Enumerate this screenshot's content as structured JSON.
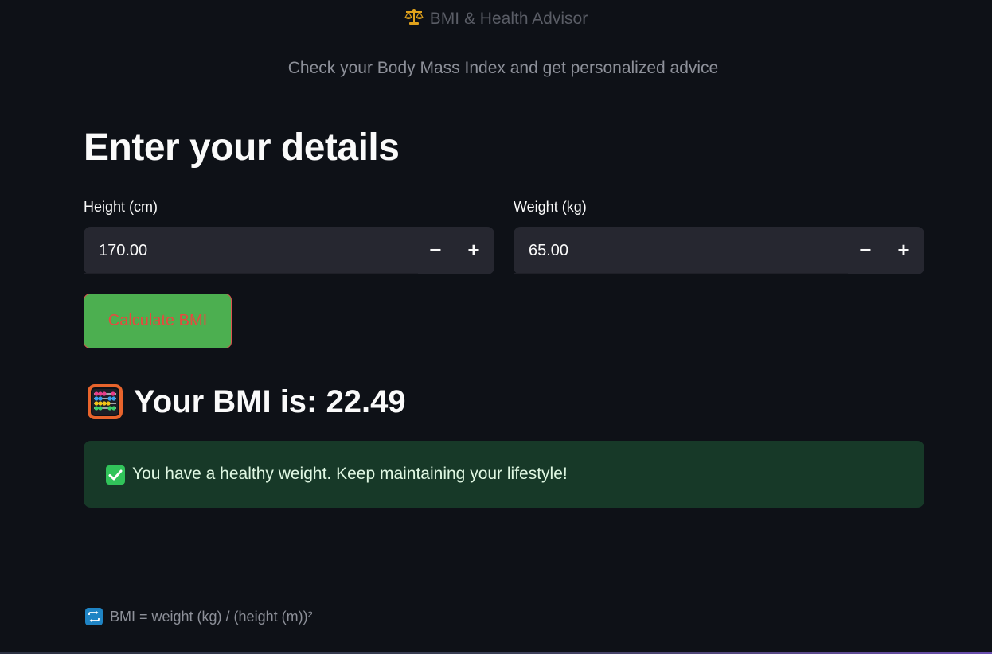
{
  "header": {
    "title": "BMI & Health Advisor",
    "subtitle": "Check your Body Mass Index and get personalized advice"
  },
  "form": {
    "heading": "Enter your details",
    "height": {
      "label": "Height (cm)",
      "value": "170.00",
      "decrement": "−",
      "increment": "+"
    },
    "weight": {
      "label": "Weight (kg)",
      "value": "65.00",
      "decrement": "−",
      "increment": "+"
    },
    "calculate_label": "Calculate BMI"
  },
  "result": {
    "icon": "abacus-icon",
    "text": "Your BMI is: 22.49",
    "message_icon": "check-mark-icon",
    "message": "You have a healthy weight. Keep maintaining your lifestyle!"
  },
  "footer": {
    "icon": "repeat-icon",
    "formula": "BMI = weight (kg) / (height (m))²"
  },
  "colors": {
    "background": "#0e1117",
    "input_background": "#262730",
    "button_background": "#4caf50",
    "button_text": "#e8483f",
    "success_background": "#173928",
    "success_check": "#31c45a"
  }
}
